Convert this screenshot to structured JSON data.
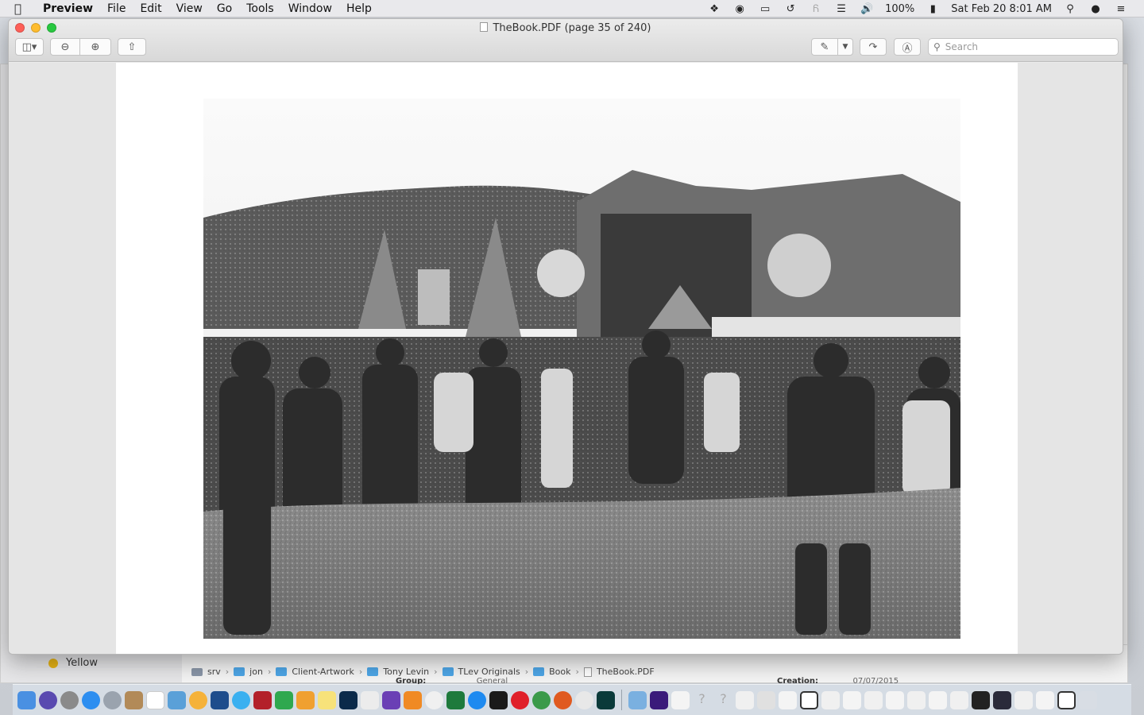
{
  "menubar": {
    "app": "Preview",
    "menus": [
      "File",
      "Edit",
      "View",
      "Go",
      "Tools",
      "Window",
      "Help"
    ],
    "battery": "100%",
    "datetime": "Sat Feb 20  8:01 AM"
  },
  "window": {
    "title": "TheBook.PDF (page 35 of 240)",
    "search_placeholder": "Search"
  },
  "background_window": {
    "tag_label": "Yellow",
    "path": [
      "srv",
      "jon",
      "Client-Artwork",
      "Tony Levin",
      "TLev Originals",
      "Book",
      "TheBook.PDF"
    ],
    "label_group": "Group:",
    "label_group_value": "General",
    "label_creation": "Creation:",
    "label_creation_value": "07/07/2015"
  },
  "colors": {
    "accent": "#4ea6e6",
    "tag_yellow": "#e7b416",
    "close": "#fe5f57",
    "minimize": "#febc2e",
    "zoom": "#28c840"
  },
  "dock": {
    "icons": [
      "finder-icon",
      "siri-icon",
      "system-preferences-icon",
      "safari-icon",
      "launchpad-icon",
      "contacts-icon",
      "calendar-icon",
      "preview-icon",
      "photos-icon",
      "xcode-icon",
      "messages-icon",
      "photo-booth-icon",
      "numbers-icon",
      "pages-icon",
      "notes-icon",
      "photoshop-icon",
      "textedit-icon",
      "imovie-icon",
      "books-icon",
      "itunes-icon",
      "excel-icon",
      "app-store-icon",
      "terminal-icon",
      "opera-icon",
      "chrome-icon",
      "firefox-icon",
      "bbedit-icon",
      "artrage-icon",
      "finder-window-icon",
      "amazon-music-icon",
      "script-icon"
    ]
  }
}
